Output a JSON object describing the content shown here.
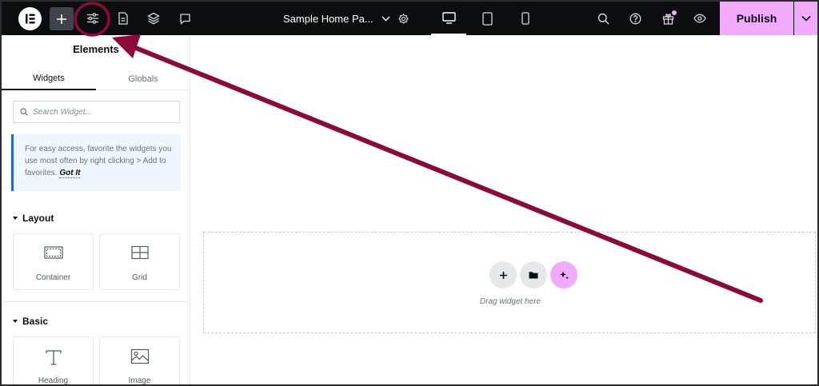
{
  "header": {
    "document_title": "Sample Home Pa...",
    "publish_label": "Publish",
    "icons": {
      "logo": "elementor-logo-icon",
      "add": "plus-icon",
      "site_settings": "sliders-icon",
      "page": "document-icon",
      "structure": "layers-icon",
      "notes": "comment-icon",
      "chevron": "chevron-down-icon",
      "page_settings": "gear-icon",
      "desktop": "desktop-icon",
      "tablet": "tablet-icon",
      "mobile": "mobile-icon",
      "search": "search-icon",
      "help": "question-icon",
      "whats_new": "gift-icon",
      "preview": "eye-icon",
      "publish_menu": "chevron-down-icon"
    }
  },
  "panel": {
    "title": "Elements",
    "tabs": [
      {
        "label": "Widgets",
        "active": true
      },
      {
        "label": "Globals",
        "active": false
      }
    ],
    "search_placeholder": "Search Widget...",
    "notice_text": "For easy access, favorite the widgets you use most often by right clicking > Add to favorites.",
    "notice_link": "Got It",
    "sections": [
      {
        "label": "Layout",
        "widgets": [
          {
            "label": "Container",
            "icon": "container-icon"
          },
          {
            "label": "Grid",
            "icon": "grid-icon"
          }
        ]
      },
      {
        "label": "Basic",
        "widgets": [
          {
            "label": "Heading",
            "icon": "heading-icon"
          },
          {
            "label": "Image",
            "icon": "image-icon"
          }
        ]
      }
    ]
  },
  "canvas": {
    "drop_text": "Drag widget here",
    "buttons": [
      "plus-icon",
      "folder-icon",
      "ai-sparkle-icon"
    ]
  },
  "colors": {
    "topbar_bg": "#0c0d0e",
    "accent_pink": "#f0abfc",
    "notice_border": "#2563eb",
    "annotation": "#8b0a3a"
  }
}
